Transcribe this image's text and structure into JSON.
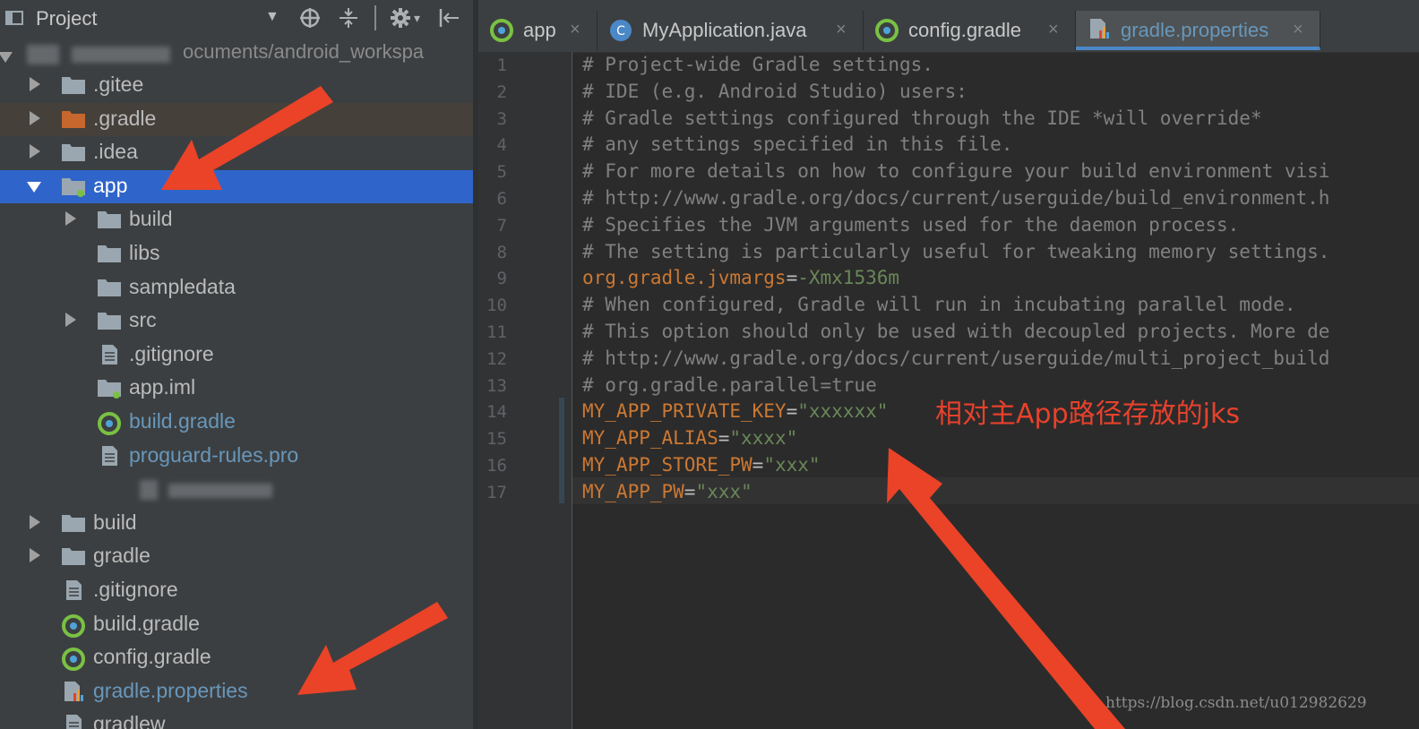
{
  "project_panel": {
    "title": "Project",
    "dropdown_glyph": "▼",
    "path_text": "ocuments/android_workspa",
    "header_icons": [
      "locate-icon",
      "collapse-icon",
      "gear-icon",
      "hide-panel-icon"
    ],
    "tree": [
      {
        "label": ".gitee",
        "icon": "folder-icon",
        "arrow": "right"
      },
      {
        "label": ".gradle",
        "icon": "folder-orange-icon",
        "arrow": "right"
      },
      {
        "label": ".idea",
        "icon": "folder-icon",
        "arrow": "right"
      },
      {
        "label": "app",
        "icon": "module-folder-icon",
        "arrow": "down"
      },
      {
        "label": "build",
        "icon": "folder-icon",
        "arrow": "right"
      },
      {
        "label": "libs",
        "icon": "folder-icon",
        "arrow": "none"
      },
      {
        "label": "sampledata",
        "icon": "folder-icon",
        "arrow": "none"
      },
      {
        "label": "src",
        "icon": "folder-icon",
        "arrow": "right"
      },
      {
        "label": ".gitignore",
        "icon": "file-icon",
        "arrow": "none"
      },
      {
        "label": "app.iml",
        "icon": "iml-file-icon",
        "arrow": "none"
      },
      {
        "label": "build.gradle",
        "icon": "gradle-icon",
        "arrow": "none"
      },
      {
        "label": "proguard-rules.pro",
        "icon": "file-icon",
        "arrow": "none"
      },
      {
        "label": "",
        "icon": "blurred-file-icon",
        "arrow": "none"
      },
      {
        "label": "build",
        "icon": "folder-icon",
        "arrow": "right"
      },
      {
        "label": "gradle",
        "icon": "folder-icon",
        "arrow": "right"
      },
      {
        "label": ".gitignore",
        "icon": "file-icon",
        "arrow": "none"
      },
      {
        "label": "build.gradle",
        "icon": "gradle-icon",
        "arrow": "none"
      },
      {
        "label": "config.gradle",
        "icon": "gradle-icon",
        "arrow": "none"
      },
      {
        "label": "gradle.properties",
        "icon": "properties-file-icon",
        "arrow": "none"
      },
      {
        "label": "gradlew",
        "icon": "file-icon",
        "arrow": "none"
      }
    ]
  },
  "editor": {
    "tabs": [
      {
        "label": "app",
        "icon": "gradle-icon",
        "close": "×"
      },
      {
        "label": "MyApplication.java",
        "icon": "java-class-icon",
        "close": "×"
      },
      {
        "label": "config.gradle",
        "icon": "gradle-icon",
        "close": "×"
      },
      {
        "label": "gradle.properties",
        "icon": "properties-file-icon",
        "close": "×",
        "active": true
      }
    ],
    "line_numbers": [
      "1",
      "2",
      "3",
      "4",
      "5",
      "6",
      "7",
      "8",
      "9",
      "10",
      "11",
      "12",
      "13",
      "14",
      "15",
      "16",
      "17"
    ],
    "lines": [
      {
        "comment": "# Project-wide Gradle settings."
      },
      {
        "comment": "# IDE (e.g. Android Studio) users:"
      },
      {
        "comment": "# Gradle settings configured through the IDE *will override*"
      },
      {
        "comment": "# any settings specified in this file."
      },
      {
        "comment": "# For more details on how to configure your build environment visi"
      },
      {
        "comment": "# http://www.gradle.org/docs/current/userguide/build_environment.h"
      },
      {
        "comment": "# Specifies the JVM arguments used for the daemon process."
      },
      {
        "comment": "# The setting is particularly useful for tweaking memory settings."
      },
      {
        "key": "org.gradle.jvmargs",
        "eq": "=",
        "value": "-Xmx1536m"
      },
      {
        "comment": "# When configured, Gradle will run in incubating parallel mode."
      },
      {
        "comment": "# This option should only be used with decoupled projects. More de"
      },
      {
        "comment": "# http://www.gradle.org/docs/current/userguide/multi_project_build"
      },
      {
        "comment": "# org.gradle.parallel=true"
      },
      {
        "key": "MY_APP_PRIVATE_KEY",
        "eq": "=",
        "value": "\"xxxxxx\""
      },
      {
        "key": "MY_APP_ALIAS",
        "eq": "=",
        "value": "\"xxxx\""
      },
      {
        "key": "MY_APP_STORE_PW",
        "eq": "=",
        "value": "\"xxx\""
      },
      {
        "key": "MY_APP_PW",
        "eq": "=",
        "value": "\"xxx\""
      }
    ],
    "annotation": "相对主App路径存放的jks"
  },
  "watermark": "https://blog.csdn.net/u012982629",
  "colors": {
    "panel_bg": "#3c3f41",
    "editor_bg": "#2b2b2b",
    "selection": "#2f65ca",
    "keyword_orange": "#cc7832",
    "string_green": "#6a8759",
    "comment_gray": "#808080",
    "link_blue": "#6897bb",
    "annotation_red": "#e8412c"
  }
}
